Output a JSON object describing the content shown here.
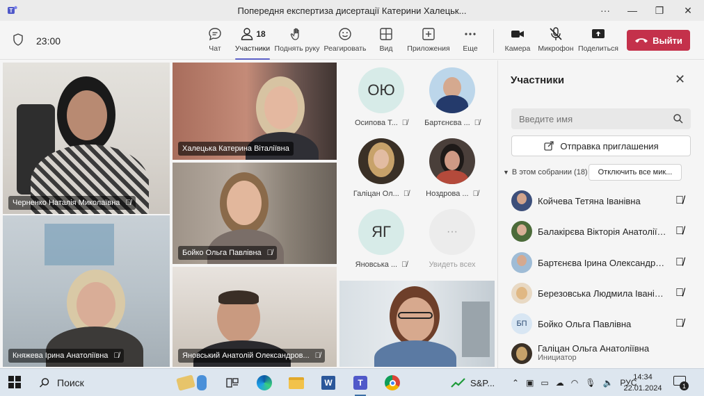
{
  "window": {
    "title": "Попередня експертиза дисертації Катерини Халецьк..."
  },
  "toolbar": {
    "timer": "23:00",
    "chat": "Чат",
    "participants": "Участники",
    "participants_count": "18",
    "raise_hand": "Поднять руку",
    "react": "Реагировать",
    "view": "Вид",
    "apps": "Приложения",
    "more": "Еще",
    "camera": "Камера",
    "microphone": "Микрофон",
    "share": "Поделиться",
    "leave": "Выйти"
  },
  "tiles": [
    {
      "name": "Черненко Наталія Миколаївна"
    },
    {
      "name": "Халецька Катерина Віталіївна"
    },
    {
      "name": "Бойко Ольга Павлівна"
    },
    {
      "name": "Княжева Ірина Анатоліївна"
    },
    {
      "name": "Яновський Анатолій Олександров..."
    }
  ],
  "mini": [
    {
      "name": "Осипова Т...",
      "initials": "ОЮ"
    },
    {
      "name": "Бартєнєва ..."
    },
    {
      "name": "Галіцан Ол..."
    },
    {
      "name": "Ноздрова ..."
    },
    {
      "name": "Яновська ...",
      "initials": "ЯГ"
    },
    {
      "name": "Увидеть всех",
      "glyph": "···"
    }
  ],
  "panel": {
    "title": "Участники",
    "search_placeholder": "Введите имя",
    "invite": "Отправка приглашения",
    "section": "В этом собрании (18)",
    "mute_all": "Отключить все мик...",
    "people": [
      {
        "name": "Койчева Тетяна Іванівна"
      },
      {
        "name": "Балакірєва Вікторія Анатоліївна"
      },
      {
        "name": "Бартєнєва Ірина Олександрівна"
      },
      {
        "name": "Березовська Людмила Іванівна"
      },
      {
        "name": "Бойко Ольга Павлівна",
        "initials": "БП"
      },
      {
        "name": "Галіцан Ольга Анатоліївна",
        "role": "Инициатор"
      }
    ]
  },
  "taskbar": {
    "search": "Поиск",
    "stock": "S&P...",
    "lang": "РУС",
    "time": "14:34",
    "date": "22.01.2024",
    "notifications": "1"
  },
  "colors": {
    "accent": "#5b5fc7",
    "leave": "#c4314b",
    "panel_bg": "#f5f5f5",
    "avatar_teal": "#d7ebe8"
  }
}
